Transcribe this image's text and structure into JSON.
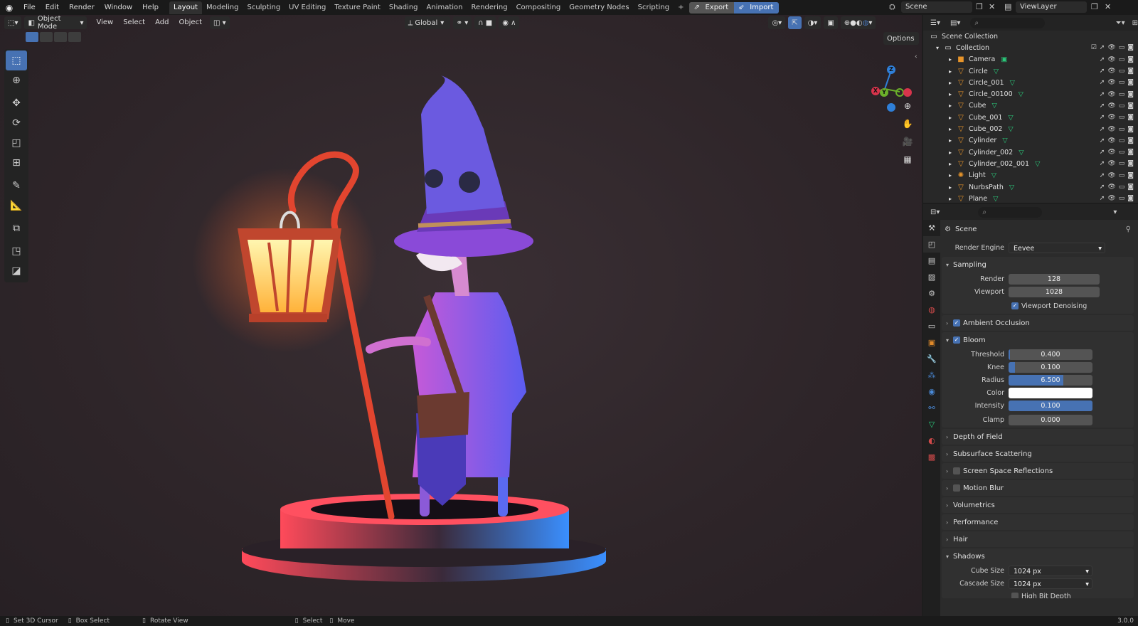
{
  "topbar": {
    "menus": [
      "File",
      "Edit",
      "Render",
      "Window",
      "Help"
    ],
    "workspaces": [
      "Layout",
      "Modeling",
      "Sculpting",
      "UV Editing",
      "Texture Paint",
      "Shading",
      "Animation",
      "Rendering",
      "Compositing",
      "Geometry Nodes",
      "Scripting"
    ],
    "add_workspace": "+",
    "export_label": "Export",
    "import_label": "Import",
    "scene_name": "Scene",
    "view_layer": "ViewLayer"
  },
  "viewport_header": {
    "mode": "Object Mode",
    "menus": [
      "View",
      "Select",
      "Add",
      "Object"
    ],
    "transform_orientation": "Global",
    "options_label": "Options"
  },
  "outliner": {
    "root": "Scene Collection",
    "collection": "Collection",
    "items": [
      "Camera",
      "Circle",
      "Circle_001",
      "Circle_00100",
      "Cube",
      "Cube_001",
      "Cube_002",
      "Cylinder",
      "Cylinder_002",
      "Cylinder_002_001",
      "Light",
      "NurbsPath",
      "Plane"
    ]
  },
  "properties": {
    "context": "Scene",
    "render_engine_label": "Render Engine",
    "render_engine": "Eevee",
    "sampling": {
      "title": "Sampling",
      "render_label": "Render",
      "render": "128",
      "viewport_label": "Viewport",
      "viewport": "1028",
      "denoise_label": "Viewport Denoising"
    },
    "ambient_occlusion": "Ambient Occlusion",
    "bloom": {
      "title": "Bloom",
      "threshold_label": "Threshold",
      "threshold": "0.400",
      "threshold_fill": 0.02,
      "knee_label": "Knee",
      "knee": "0.100",
      "knee_fill": 0.08,
      "radius_label": "Radius",
      "radius": "6.500",
      "radius_fill": 0.65,
      "color_label": "Color",
      "color": "#ffffff",
      "intensity_label": "Intensity",
      "intensity": "0.100",
      "intensity_fill": 1.0,
      "clamp_label": "Clamp",
      "clamp": "0.000"
    },
    "panels": [
      "Depth of Field",
      "Subsurface Scattering",
      "Screen Space Reflections",
      "Motion Blur",
      "Volumetrics",
      "Performance",
      "Hair",
      "Shadows"
    ],
    "shadows": {
      "cube_label": "Cube Size",
      "cube": "1024 px",
      "cascade_label": "Cascade Size",
      "cascade": "1024 px",
      "high_bit_label": "High Bit Depth"
    }
  },
  "statusbar": {
    "cursor": "Set 3D Cursor",
    "box": "Box Select",
    "rotate": "Rotate View",
    "select": "Select",
    "move": "Move",
    "version": "3.0.0"
  },
  "colors": {
    "accent": "#4772b3",
    "selected_tool": "#4772b3"
  }
}
